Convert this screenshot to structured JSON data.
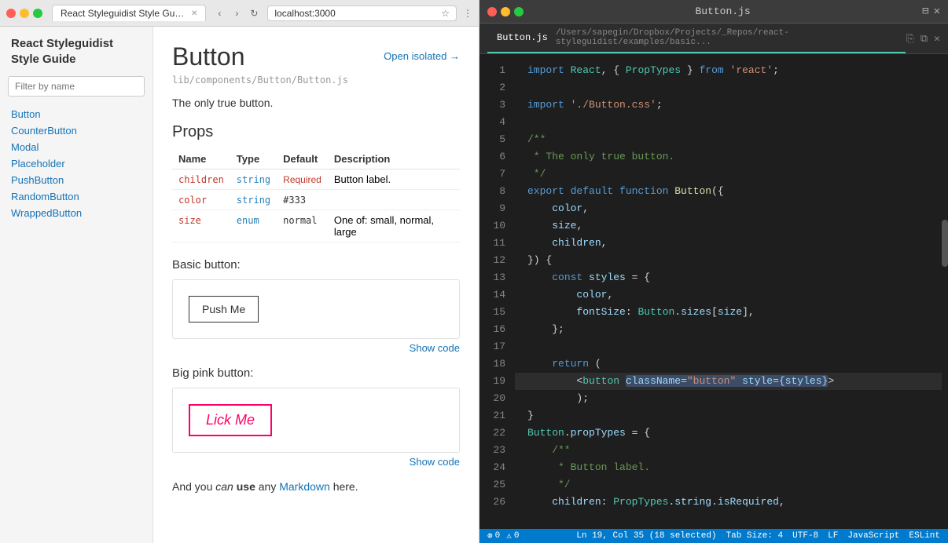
{
  "browser": {
    "title": "React Styleguidist Style Guide",
    "url": "localhost:3000",
    "tab_label": "React Styleguidist Style Guide"
  },
  "sidebar": {
    "title": "React Styleguidist\nStyle Guide",
    "filter_placeholder": "Filter by name",
    "nav_items": [
      "Button",
      "CounterButton",
      "Modal",
      "Placeholder",
      "PushButton",
      "RandomButton",
      "WrappedButton"
    ]
  },
  "main": {
    "component_title": "Button",
    "file_path": "lib/components/Button/Button.js",
    "open_isolated_label": "Open isolated →",
    "description": "The only true button.",
    "props_section_title": "Props",
    "props_table": {
      "headers": [
        "Name",
        "Type",
        "Default",
        "Description"
      ],
      "rows": [
        {
          "name": "children",
          "type": "string",
          "default": "Required",
          "default_class": "required",
          "description": "Button label."
        },
        {
          "name": "color",
          "type": "string",
          "default": "#333",
          "default_class": "normal",
          "description": ""
        },
        {
          "name": "size",
          "type": "enum",
          "default": "normal",
          "default_class": "normal",
          "description": "One of: small, normal, large"
        }
      ]
    },
    "examples": [
      {
        "title": "Basic button:",
        "button_label": "Push Me",
        "button_style": "default",
        "show_code_label": "Show code"
      },
      {
        "title": "Big pink button:",
        "button_label": "Lick Me",
        "button_style": "pink",
        "show_code_label": "Show code"
      }
    ],
    "markdown_text": "And you can use any Markdown here.",
    "markdown_can": "can",
    "markdown_use": "use",
    "markdown_link": "Markdown"
  },
  "editor": {
    "window_title": "Button.js",
    "tab": {
      "filename": "Button.js",
      "path": "/Users/sapegin/Dropbox/Projects/_Repos/react-styleguidist/examples/basic..."
    },
    "code_lines": [
      {
        "num": 1,
        "content": "import React, { PropTypes } from 'react';"
      },
      {
        "num": 2,
        "content": ""
      },
      {
        "num": 3,
        "content": "import './Button.css';"
      },
      {
        "num": 4,
        "content": ""
      },
      {
        "num": 5,
        "content": "/**"
      },
      {
        "num": 6,
        "content": " * The only true button."
      },
      {
        "num": 7,
        "content": " */"
      },
      {
        "num": 8,
        "content": "export default function Button({"
      },
      {
        "num": 9,
        "content": "    color,"
      },
      {
        "num": 10,
        "content": "    size,"
      },
      {
        "num": 11,
        "content": "    children,"
      },
      {
        "num": 12,
        "content": "}) {"
      },
      {
        "num": 13,
        "content": "    const styles = {"
      },
      {
        "num": 14,
        "content": "        color,"
      },
      {
        "num": 15,
        "content": "        fontSize: Button.sizes[size],"
      },
      {
        "num": 16,
        "content": "    };"
      },
      {
        "num": 17,
        "content": ""
      },
      {
        "num": 18,
        "content": "    return ("
      },
      {
        "num": 19,
        "content": "        <button className=\"button\" style={styles}>"
      },
      {
        "num": 20,
        "content": "        );"
      },
      {
        "num": 21,
        "content": "}"
      },
      {
        "num": 22,
        "content": "Button.propTypes = {"
      },
      {
        "num": 23,
        "content": "    /**"
      },
      {
        "num": 24,
        "content": "     * Button label."
      },
      {
        "num": 25,
        "content": "     */"
      },
      {
        "num": 26,
        "content": "    children: PropTypes.string.isRequired,"
      }
    ],
    "statusbar": {
      "ln": "Ln 19",
      "col": "Col 35",
      "selected": "(18 selected)",
      "tab_size": "Tab Size: 4",
      "encoding": "UTF-8",
      "line_ending": "LF",
      "language": "JavaScript",
      "linter": "ESLint",
      "errors": "0",
      "warnings": "0"
    }
  }
}
